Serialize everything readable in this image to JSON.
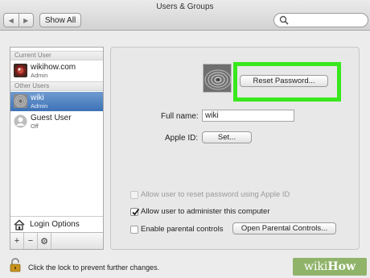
{
  "window": {
    "title": "Users & Groups"
  },
  "toolbar": {
    "back_icon": "chevron-left-icon",
    "forward_icon": "chevron-right-icon",
    "show_all_label": "Show All",
    "search_placeholder": ""
  },
  "sidebar": {
    "current_user_header": "Current User",
    "current_user": {
      "name": "wikihow.com",
      "role": "Admin"
    },
    "other_users_header": "Other Users",
    "other_users": [
      {
        "name": "wiki",
        "role": "Admin",
        "selected": true
      },
      {
        "name": "Guest User",
        "role": "Off",
        "selected": false
      }
    ],
    "login_options_label": "Login Options",
    "tools": [
      "+",
      "−",
      "⚙"
    ]
  },
  "details": {
    "reset_password_label": "Reset Password...",
    "full_name_label": "Full name:",
    "full_name_value": "wiki",
    "apple_id_label": "Apple ID:",
    "apple_id_button": "Set...",
    "allow_reset_label": "Allow user to reset password using Apple ID",
    "allow_reset_checked": false,
    "allow_admin_label": "Allow user to administer this computer",
    "allow_admin_checked": true,
    "parental_label": "Enable parental controls",
    "parental_checked": false,
    "open_parental_label": "Open Parental Controls..."
  },
  "footer": {
    "lock_text": "Click the lock to prevent further changes."
  },
  "watermark": {
    "wiki": "wiki",
    "how": "How"
  },
  "colors": {
    "highlight": "#38e81d",
    "selection": "#3d72b6"
  }
}
